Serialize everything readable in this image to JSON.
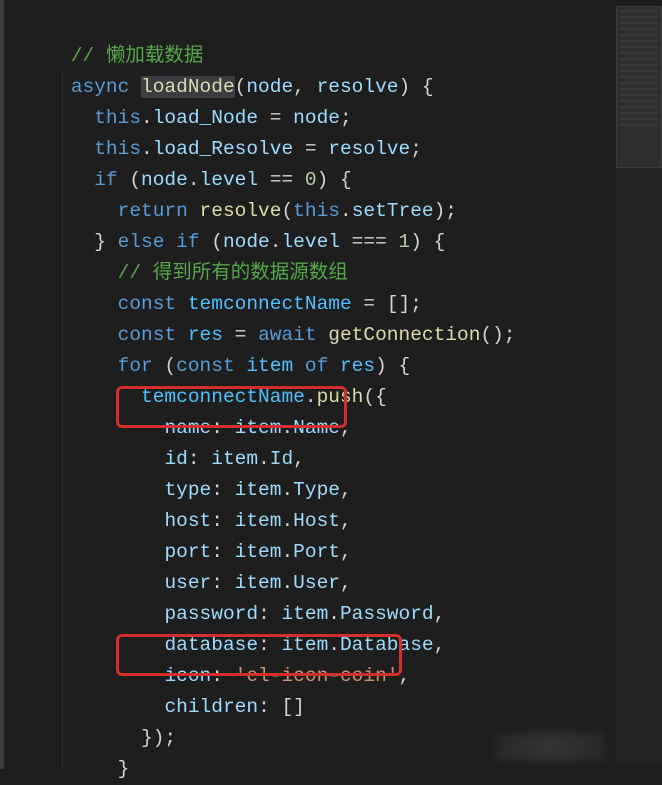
{
  "comment_top": "// 懒加载数据",
  "kw_async": "async",
  "fn_name": "loadNode",
  "params_open": "(",
  "param_node": "node",
  "sep": ", ",
  "param_resolve": "resolve",
  "params_close": ") {",
  "l_this": "this",
  "l_dot": ".",
  "prop_load_Node": "load_Node",
  "eq": " = ",
  "var_node": "node",
  "semi": ";",
  "prop_load_Resolve": "load_Resolve",
  "var_resolve": "resolve",
  "kw_if": "if",
  "kw_else": "else",
  "kw_return": "return",
  "kw_const": "const",
  "kw_await": "await",
  "kw_for": "for",
  "kw_of": "of",
  "open_paren": " (",
  "close_paren_brace": ") {",
  "close_brace": "}",
  "close_brace_semi": "});",
  "open_brace": "{",
  "prop_level": "level",
  "num0": "0",
  "num1": "1",
  "eqeq": " == ",
  "eqeqeq": " === ",
  "prop_setTree": "setTree",
  "comment_inner": "// 得到所有的数据源数组",
  "var_temconnectName": "temconnectName",
  "empty_arr": "[]",
  "var_res": "res",
  "fn_getConnection": "getConnection",
  "call_empty": "();",
  "var_item": "item",
  "fn_push": "push",
  "push_open": "({",
  "k_name": "name",
  "v_Name": "Name",
  "k_id": "id",
  "v_Id": "Id",
  "k_type": "type",
  "v_Type": "Type",
  "k_host": "host",
  "v_Host": "Host",
  "k_port": "port",
  "v_Port": "Port",
  "k_user": "user",
  "v_User": "User",
  "k_password": "password",
  "v_Password": "Password",
  "k_database": "database",
  "v_Database": "Database",
  "k_icon": "icon",
  "str_icon": "'el-icon-coin'",
  "k_children": "children",
  "colon": ": ",
  "comma": ",",
  "resolve_open": "(",
  "resolve_close": ");"
}
